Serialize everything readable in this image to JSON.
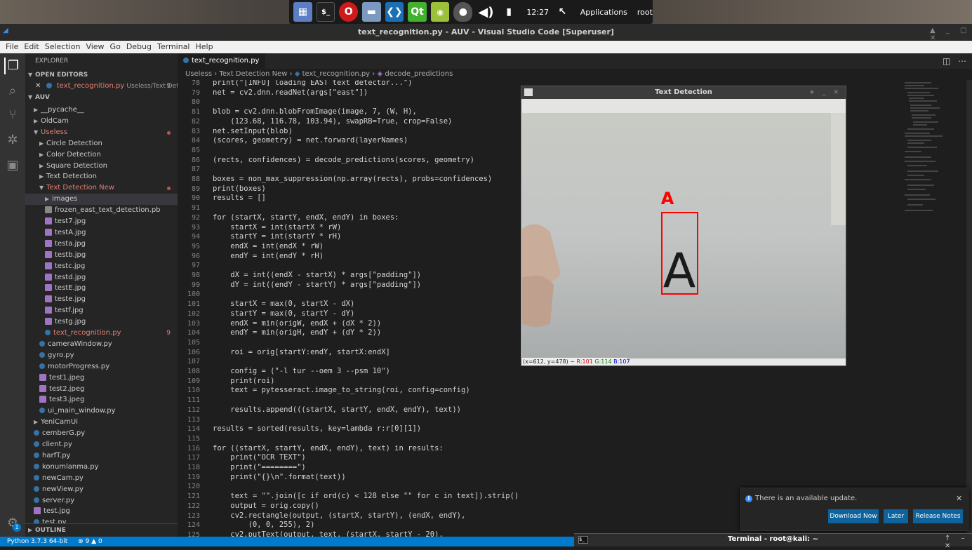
{
  "taskbar": {
    "clock": "12:27",
    "apps_label": "Applications",
    "user": "root",
    "icons": [
      "files-icon",
      "terminal-icon",
      "opera-icon",
      "folder-icon",
      "vscode-icon",
      "qt-icon",
      "android-icon",
      "alien-icon",
      "volume-icon",
      "battery-icon",
      "cursor-icon"
    ]
  },
  "window": {
    "title": "text_recognition.py - AUV - Visual Studio Code [Superuser]"
  },
  "menu": [
    "File",
    "Edit",
    "Selection",
    "View",
    "Go",
    "Debug",
    "Terminal",
    "Help"
  ],
  "sidebar": {
    "explorer_label": "EXPLORER",
    "open_editors_label": "OPEN EDITORS",
    "open_editor": {
      "name": "text_recognition.py",
      "path": "Useless/Text Det...",
      "count": "9"
    },
    "root_label": "AUV",
    "outline_label": "OUTLINE",
    "tree": [
      {
        "label": "__pycache__",
        "type": "folder",
        "depth": 1,
        "open": false
      },
      {
        "label": "OldCam",
        "type": "folder",
        "depth": 1,
        "open": false
      },
      {
        "label": "Useless",
        "type": "folder",
        "depth": 1,
        "open": true,
        "modified": true
      },
      {
        "label": "Circle Detection",
        "type": "folder",
        "depth": 2,
        "open": false
      },
      {
        "label": "Color Detection",
        "type": "folder",
        "depth": 2,
        "open": false
      },
      {
        "label": "Square Detection",
        "type": "folder",
        "depth": 2,
        "open": false
      },
      {
        "label": "Text Detection",
        "type": "folder",
        "depth": 2,
        "open": false
      },
      {
        "label": "Text Detection New",
        "type": "folder",
        "depth": 2,
        "open": true,
        "modified": true
      },
      {
        "label": "images",
        "type": "folder",
        "depth": 3,
        "open": false,
        "selected": true
      },
      {
        "label": "frozen_east_text_detection.pb",
        "type": "file",
        "depth": 3
      },
      {
        "label": "test7.jpg",
        "type": "image",
        "depth": 3
      },
      {
        "label": "testA.jpg",
        "type": "image",
        "depth": 3
      },
      {
        "label": "testa.jpg",
        "type": "image",
        "depth": 3
      },
      {
        "label": "testb.jpg",
        "type": "image",
        "depth": 3
      },
      {
        "label": "testc.jpg",
        "type": "image",
        "depth": 3
      },
      {
        "label": "testd.jpg",
        "type": "image",
        "depth": 3
      },
      {
        "label": "testE.jpg",
        "type": "image",
        "depth": 3
      },
      {
        "label": "teste.jpg",
        "type": "image",
        "depth": 3
      },
      {
        "label": "testf.jpg",
        "type": "image",
        "depth": 3
      },
      {
        "label": "testg.jpg",
        "type": "image",
        "depth": 3
      },
      {
        "label": "text_recognition.py",
        "type": "python",
        "depth": 3,
        "modified": true,
        "count": "9"
      },
      {
        "label": "cameraWindow.py",
        "type": "python",
        "depth": 2
      },
      {
        "label": "gyro.py",
        "type": "python",
        "depth": 2
      },
      {
        "label": "motorProgress.py",
        "type": "python",
        "depth": 2
      },
      {
        "label": "test1.jpeg",
        "type": "image",
        "depth": 2
      },
      {
        "label": "test2.jpeg",
        "type": "image",
        "depth": 2
      },
      {
        "label": "test3.jpeg",
        "type": "image",
        "depth": 2
      },
      {
        "label": "ui_main_window.py",
        "type": "python",
        "depth": 2
      },
      {
        "label": "YeniCamUi",
        "type": "folder",
        "depth": 1,
        "open": false
      },
      {
        "label": "cemberG.py",
        "type": "python",
        "depth": 1
      },
      {
        "label": "client.py",
        "type": "python",
        "depth": 1
      },
      {
        "label": "harfT.py",
        "type": "python",
        "depth": 1
      },
      {
        "label": "konumlanma.py",
        "type": "python",
        "depth": 1
      },
      {
        "label": "newCam.py",
        "type": "python",
        "depth": 1
      },
      {
        "label": "newView.py",
        "type": "python",
        "depth": 1
      },
      {
        "label": "server.py",
        "type": "python",
        "depth": 1
      },
      {
        "label": "test.jpg",
        "type": "image",
        "depth": 1
      },
      {
        "label": "test.py",
        "type": "python",
        "depth": 1
      }
    ]
  },
  "editor": {
    "tab_label": "text_recognition.py",
    "breadcrumbs": [
      "Useless",
      "Text Detection New",
      "text_recognition.py",
      "decode_predictions"
    ],
    "lines": [
      {
        "n": "78",
        "t": "print(\"[INFO] loading EAST text detector...\")"
      },
      {
        "n": "79",
        "t": "net = cv2.dnn.readNet(args[\"east\"])"
      },
      {
        "n": "80",
        "t": ""
      },
      {
        "n": "81",
        "t": "blob = cv2.dnn.blobFromImage(image, 7, (W, H),"
      },
      {
        "n": "82",
        "t": "    (123.68, 116.78, 103.94), swapRB=True, crop=False)"
      },
      {
        "n": "83",
        "t": "net.setInput(blob)"
      },
      {
        "n": "84",
        "t": "(scores, geometry) = net.forward(layerNames)"
      },
      {
        "n": "85",
        "t": ""
      },
      {
        "n": "86",
        "t": "(rects, confidences) = decode_predictions(scores, geometry)"
      },
      {
        "n": "87",
        "t": ""
      },
      {
        "n": "88",
        "t": "boxes = non_max_suppression(np.array(rects), probs=confidences)"
      },
      {
        "n": "89",
        "t": "print(boxes)"
      },
      {
        "n": "90",
        "t": "results = []"
      },
      {
        "n": "91",
        "t": ""
      },
      {
        "n": "92",
        "t": "for (startX, startY, endX, endY) in boxes:"
      },
      {
        "n": "93",
        "t": "    startX = int(startX * rW)"
      },
      {
        "n": "94",
        "t": "    startY = int(startY * rH)"
      },
      {
        "n": "95",
        "t": "    endX = int(endX * rW)"
      },
      {
        "n": "96",
        "t": "    endY = int(endY * rH)"
      },
      {
        "n": "97",
        "t": ""
      },
      {
        "n": "98",
        "t": "    dX = int((endX - startX) * args[\"padding\"])"
      },
      {
        "n": "99",
        "t": "    dY = int((endY - startY) * args[\"padding\"])"
      },
      {
        "n": "100",
        "t": ""
      },
      {
        "n": "101",
        "t": "    startX = max(0, startX - dX)"
      },
      {
        "n": "102",
        "t": "    startY = max(0, startY - dY)"
      },
      {
        "n": "103",
        "t": "    endX = min(origW, endX + (dX * 2))"
      },
      {
        "n": "104",
        "t": "    endY = min(origH, endY + (dY * 2))"
      },
      {
        "n": "105",
        "t": ""
      },
      {
        "n": "106",
        "t": "    roi = orig[startY:endY, startX:endX]"
      },
      {
        "n": "107",
        "t": ""
      },
      {
        "n": "108",
        "t": "    config = (\"-l tur --oem 3 --psm 10\")"
      },
      {
        "n": "109",
        "t": "    print(roi)"
      },
      {
        "n": "110",
        "t": "    text = pytesseract.image_to_string(roi, config=config)"
      },
      {
        "n": "111",
        "t": ""
      },
      {
        "n": "112",
        "t": "    results.append(((startX, startY, endX, endY), text))"
      },
      {
        "n": "113",
        "t": ""
      },
      {
        "n": "114",
        "t": "results = sorted(results, key=lambda r:r[0][1])"
      },
      {
        "n": "115",
        "t": ""
      },
      {
        "n": "116",
        "t": "for ((startX, startY, endX, endY), text) in results:"
      },
      {
        "n": "117",
        "t": "    print(\"OCR TEXT\")"
      },
      {
        "n": "118",
        "t": "    print(\"========\")"
      },
      {
        "n": "119",
        "t": "    print(\"{}\\n\".format(text))"
      },
      {
        "n": "120",
        "t": ""
      },
      {
        "n": "121",
        "t": "    text = \"\".join([c if ord(c) < 128 else \"\" for c in text]).strip()"
      },
      {
        "n": "122",
        "t": "    output = orig.copy()"
      },
      {
        "n": "123",
        "t": "    cv2.rectangle(output, (startX, startY), (endX, endY),"
      },
      {
        "n": "124",
        "t": "        (0, 0, 255), 2)"
      },
      {
        "n": "125",
        "t": "    cv2.putText(output, text, (startX, startY - 20),"
      }
    ]
  },
  "text_detection_window": {
    "title": "Text Detection",
    "detected_text": "A",
    "letter": "A",
    "status_coords": "(x=612, y=478) ~",
    "status_r": "R:101",
    "status_g": "G:114",
    "status_b": "B:107"
  },
  "notification": {
    "message": "There is an available update.",
    "download": "Download Now",
    "later": "Later",
    "release_notes": "Release Notes"
  },
  "statusbar": {
    "python": "Python 3.7.3 64-bit",
    "errors": "9",
    "warnings": "0",
    "settings_badge": "1"
  },
  "terminal_taskbar": {
    "title": "Terminal - root@kali: ~"
  },
  "colors": {
    "accent": "#007acc",
    "modified": "#e37e74",
    "detection_box": "#ff0000"
  }
}
